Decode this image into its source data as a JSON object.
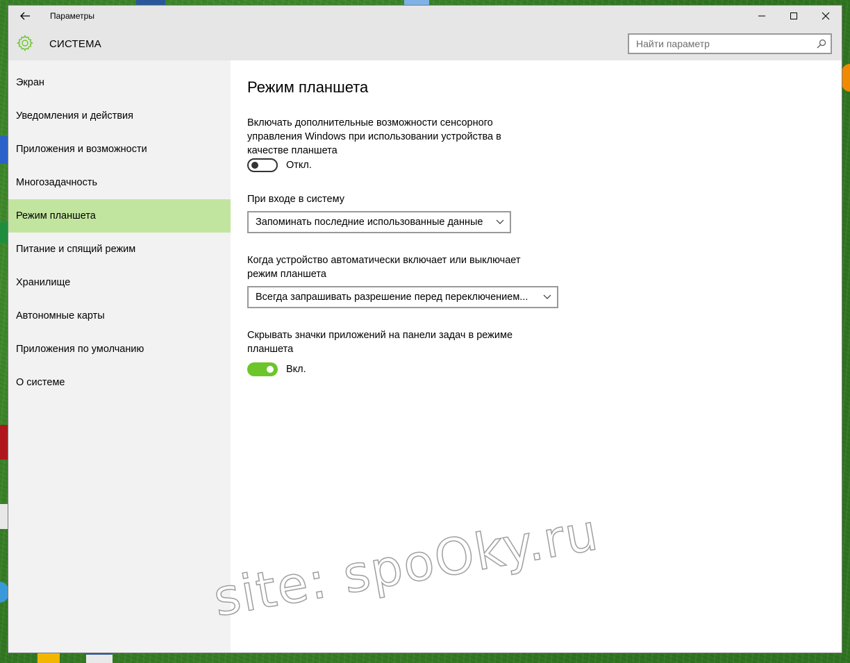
{
  "window": {
    "title": "Параметры"
  },
  "header": {
    "title": "СИСТЕМА",
    "search_placeholder": "Найти параметр",
    "accent_color": "#6cc62b"
  },
  "sidebar": {
    "items": [
      {
        "label": "Экран"
      },
      {
        "label": "Уведомления и действия"
      },
      {
        "label": "Приложения и возможности"
      },
      {
        "label": "Многозадачность"
      },
      {
        "label": "Режим планшета",
        "selected": true
      },
      {
        "label": "Питание и спящий режим"
      },
      {
        "label": "Хранилище"
      },
      {
        "label": "Автономные карты"
      },
      {
        "label": "Приложения по умолчанию"
      },
      {
        "label": "О системе"
      }
    ],
    "selected_color": "#c1e59e"
  },
  "main": {
    "title": "Режим планшета",
    "touch_setting": {
      "description": "Включать дополнительные возможности сенсорного управления Windows при использовании устройства в качестве планшета",
      "state": "Откл.",
      "on": false
    },
    "sign_in": {
      "label": "При входе в систему",
      "value": "Запоминать последние использованные данные"
    },
    "auto_switch": {
      "label": "Когда устройство автоматически включает или выключает режим планшета",
      "value": "Всегда запрашивать разрешение перед переключением..."
    },
    "hide_icons": {
      "description": "Скрывать значки приложений на панели задач в режиме планшета",
      "state": "Вкл.",
      "on": true
    }
  },
  "watermark": "site: spoOky.ru"
}
